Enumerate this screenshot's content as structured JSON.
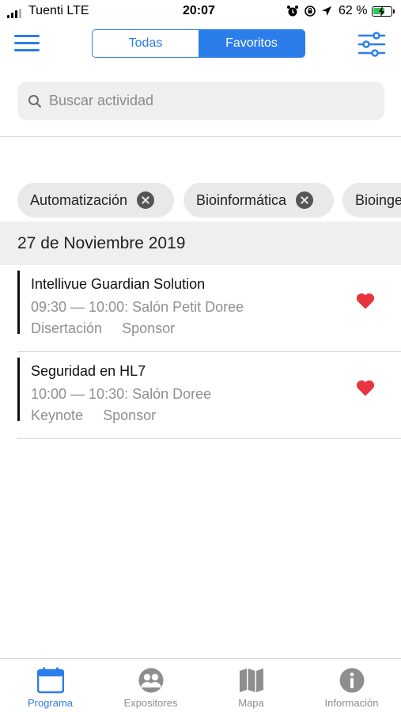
{
  "status_bar": {
    "carrier": "Tuenti",
    "network": "LTE",
    "time": "20:07",
    "battery": "62 %"
  },
  "nav": {
    "segments": [
      "Todas",
      "Favoritos"
    ],
    "active_segment": "Favoritos",
    "menu_icon": "hamburger-menu-icon",
    "filter_icon": "sliders-icon"
  },
  "search": {
    "placeholder": "Buscar actividad",
    "value": ""
  },
  "filter_chips": [
    {
      "label": "Automatización"
    },
    {
      "label": "Bioinformática"
    },
    {
      "label": "Bioingeniería"
    }
  ],
  "schedule": {
    "date": "27 de Noviembre 2019",
    "events": [
      {
        "title": "Intellivue Guardian Solution",
        "time": "09:30 — 10:00: Salón Petit Doree",
        "tags": [
          "Disertación",
          "Sponsor"
        ],
        "favorite": true
      },
      {
        "title": "Seguridad en HL7",
        "time": "10:00 — 10:30: Salón Doree",
        "tags": [
          "Keynote",
          "Sponsor"
        ],
        "favorite": true
      }
    ]
  },
  "tabbar": {
    "items": [
      {
        "label": "Programa",
        "icon": "calendar-icon",
        "active": true
      },
      {
        "label": "Expositores",
        "icon": "people-icon",
        "active": false
      },
      {
        "label": "Mapa",
        "icon": "map-icon",
        "active": false
      },
      {
        "label": "Información",
        "icon": "info-icon",
        "active": false
      }
    ]
  },
  "colors": {
    "accent": "#2b7de9",
    "favorite": "#e8343e",
    "inactive_tab": "#8e8e8e"
  }
}
